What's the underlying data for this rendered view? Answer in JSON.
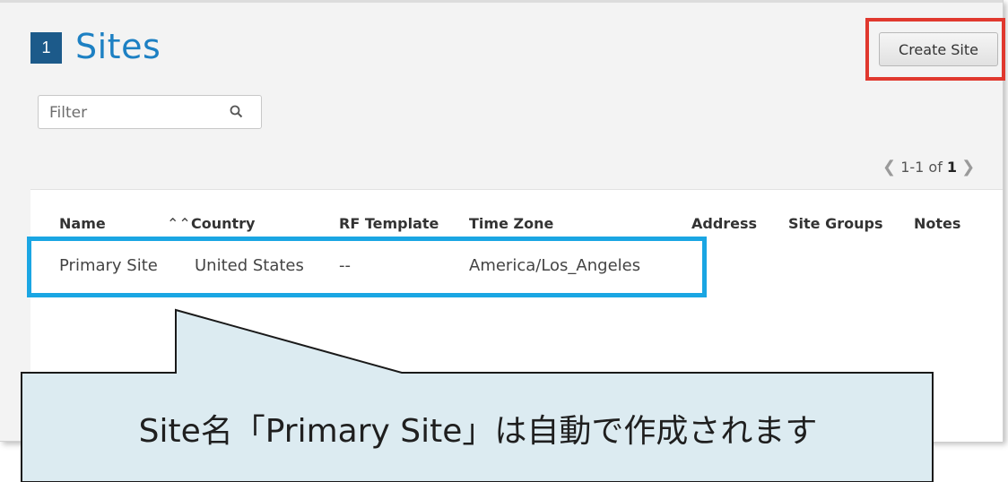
{
  "header": {
    "step_number": "1",
    "title": "Sites",
    "create_button_label": "Create Site"
  },
  "filter": {
    "placeholder": "Filter",
    "value": "",
    "icon": "search-icon"
  },
  "pagination": {
    "range": "1-1 of ",
    "total": "1",
    "prev_icon": "chevron-left-icon",
    "next_icon": "chevron-right-icon"
  },
  "table": {
    "columns": [
      "Name",
      "Country",
      "RF Template",
      "Time Zone",
      "Address",
      "Site Groups",
      "Notes"
    ],
    "sort_icon": "double-chevron-up-icon",
    "rows": [
      {
        "name": "Primary Site",
        "country": "United States",
        "rf_template": "--",
        "time_zone": "America/Los_Angeles",
        "address": "",
        "site_groups": "",
        "notes": ""
      }
    ]
  },
  "annotation": {
    "callout_text": "Site名「Primary Site」は自動で作成されます",
    "highlight_colors": {
      "create_button_box": "#e0382e",
      "row_box": "#1aa6e3"
    },
    "callout_fill": "#dcebf1"
  },
  "colors": {
    "title": "#1d80c3",
    "badge": "#1c5a8a",
    "background": "#f3f3f3"
  }
}
